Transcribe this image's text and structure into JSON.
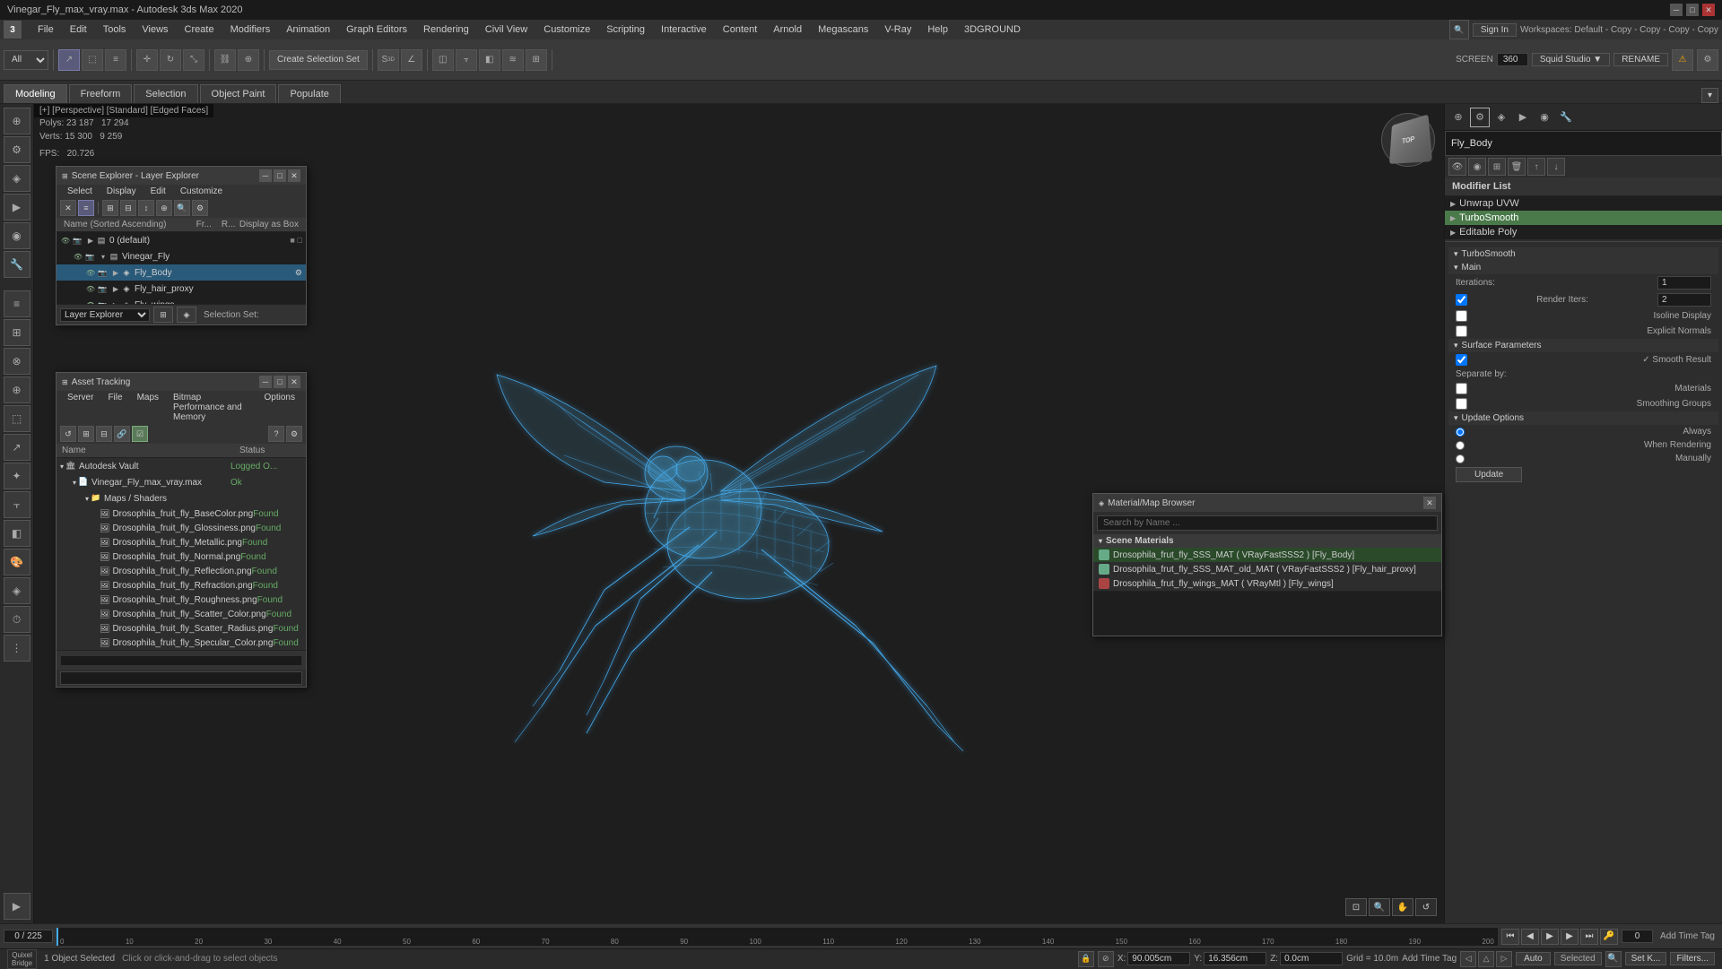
{
  "app": {
    "title": "Vinegar_Fly_max_vray.max - Autodesk 3ds Max 2020",
    "window_controls": [
      "minimize",
      "restore",
      "close"
    ]
  },
  "menu": {
    "items": [
      "File",
      "Edit",
      "Tools",
      "Views",
      "Create",
      "Modifiers",
      "Animation",
      "Graph Editors",
      "Rendering",
      "Civil View",
      "Customize",
      "Scripting",
      "Interactive",
      "Content",
      "Arnold",
      "Megascans",
      "V-Ray",
      "Help",
      "3DGROUND"
    ]
  },
  "toolbar": {
    "create_selection_label": "Create Selection Set",
    "screen_label": "SCREEN",
    "frame_label": "360",
    "workspace_label": "Squid Studio ▼",
    "rename_label": "RENAME",
    "filter_label": "All"
  },
  "tabs": {
    "items": [
      "Modeling",
      "Freeform",
      "Selection",
      "Object Paint",
      "Populate"
    ]
  },
  "viewport": {
    "header": "[+] [Perspective] [Standard] [Edged Faces]",
    "stats": {
      "polys_label": "Polys:",
      "polys_total": "23 187",
      "polys_value": "17 294",
      "verts_label": "Verts:",
      "verts_total": "15 300",
      "verts_value": "9 259",
      "fps_label": "FPS:",
      "fps_value": "20.726"
    }
  },
  "scene_explorer": {
    "title": "Scene Explorer - Layer Explorer",
    "menu": [
      "Select",
      "Display",
      "Edit",
      "Customize"
    ],
    "columns": {
      "name": "Name (Sorted Ascending)",
      "fr": "Fr...",
      "r": "R...",
      "display": "Display as Box"
    },
    "tree": [
      {
        "indent": 0,
        "expand": false,
        "name": "0 (default)",
        "level": 0
      },
      {
        "indent": 1,
        "expand": true,
        "name": "Vinegar_Fly",
        "level": 1
      },
      {
        "indent": 2,
        "expand": false,
        "name": "Fly_Body",
        "level": 2,
        "selected": true
      },
      {
        "indent": 2,
        "expand": false,
        "name": "Fly_hair_proxy",
        "level": 2
      },
      {
        "indent": 2,
        "expand": false,
        "name": "Fly_wings",
        "level": 2
      }
    ],
    "footer": {
      "label": "Layer Explorer",
      "selection_set_label": "Selection Set:"
    }
  },
  "asset_tracking": {
    "title": "Asset Tracking",
    "menu": [
      "Server",
      "File",
      "Maps",
      "Bitmap Performance and Memory",
      "Options"
    ],
    "columns": [
      "Name",
      "Status"
    ],
    "assets": [
      {
        "indent": 0,
        "type": "folder",
        "name": "Autodesk Vault",
        "status": "Logged O..."
      },
      {
        "indent": 1,
        "type": "file",
        "name": "Vinegar_Fly_max_vray.max",
        "status": "Ok"
      },
      {
        "indent": 2,
        "type": "folder",
        "name": "Maps / Shaders",
        "status": ""
      },
      {
        "indent": 3,
        "type": "image",
        "name": "Drosophila_fruit_fly_BaseColor.png",
        "status": "Found"
      },
      {
        "indent": 3,
        "type": "image",
        "name": "Drosophila_fruit_fly_Glossiness.png",
        "status": "Found"
      },
      {
        "indent": 3,
        "type": "image",
        "name": "Drosophila_fruit_fly_Metallic.png",
        "status": "Found"
      },
      {
        "indent": 3,
        "type": "image",
        "name": "Drosophila_fruit_fly_Normal.png",
        "status": "Found"
      },
      {
        "indent": 3,
        "type": "image",
        "name": "Drosophila_fruit_fly_Reflection.png",
        "status": "Found"
      },
      {
        "indent": 3,
        "type": "image",
        "name": "Drosophila_fruit_fly_Refraction.png",
        "status": "Found"
      },
      {
        "indent": 3,
        "type": "image",
        "name": "Drosophila_fruit_fly_Roughness.png",
        "status": "Found"
      },
      {
        "indent": 3,
        "type": "image",
        "name": "Drosophila_fruit_fly_Scatter_Color.png",
        "status": "Found"
      },
      {
        "indent": 3,
        "type": "image",
        "name": "Drosophila_fruit_fly_Scatter_Radius.png",
        "status": "Found"
      },
      {
        "indent": 3,
        "type": "image",
        "name": "Drosophila_fruit_fly_Specular_Color.png",
        "status": "Found"
      }
    ]
  },
  "material_browser": {
    "title": "Material/Map Browser",
    "search_placeholder": "Search by Name ...",
    "section": "Scene Materials",
    "materials": [
      {
        "name": "Drosophila_frut_fly_SSS_MAT ( VRayFastSSS2 ) [Fly_Body]",
        "selected": true
      },
      {
        "name": "Drosophila_frut_fly_SSS_MAT_old_MAT ( VRayFastSSS2 ) [Fly_hair_proxy]",
        "selected": false
      },
      {
        "name": "Drosophila_frut_fly_wings_MAT ( VRayMtl ) [Fly_wings]",
        "selected": false,
        "has_red": true
      }
    ]
  },
  "right_panel": {
    "object_name": "Fly_Body",
    "modifier_list_label": "Modifier List",
    "modifiers": [
      {
        "name": "Unwrap UVW",
        "selected": false
      },
      {
        "name": "TurboSmooth",
        "selected": true
      },
      {
        "name": "Editable Poly",
        "selected": false
      }
    ],
    "turbosmooth": {
      "label": "TurboSmooth",
      "main_label": "Main",
      "iterations_label": "Iterations:",
      "iterations_value": "1",
      "render_iters_label": "Render Iters:",
      "render_iters_value": "2",
      "isoline_display_label": "Isoline Display",
      "explicit_normals_label": "Explicit Normals",
      "surface_params_label": "Surface Parameters",
      "smooth_result_label": "✓ Smooth Result",
      "separate_by_label": "Separate by:",
      "materials_label": "Materials",
      "smoothing_groups_label": "Smoothing Groups",
      "update_options_label": "Update Options",
      "always_label": "Always",
      "when_rendering_label": "When Rendering",
      "manually_label": "Manually",
      "update_btn_label": "Update"
    }
  },
  "timeline": {
    "current": "0 / 225",
    "markers": [
      "0",
      "10",
      "20",
      "30",
      "40",
      "50",
      "60",
      "70",
      "80",
      "90",
      "100",
      "110",
      "120",
      "130",
      "140",
      "150",
      "160",
      "170",
      "180",
      "190",
      "200"
    ]
  },
  "status_bar": {
    "object_selected": "1 Object Selected",
    "hint": "Click or click-and-drag to select objects",
    "x_label": "X:",
    "x_value": "90.005cm",
    "y_label": "Y:",
    "y_value": "16.356cm",
    "z_label": "Z:",
    "z_value": "0.0cm",
    "grid_label": "Grid = 10.0m",
    "add_time_tag_label": "Add Time Tag",
    "selected_label": "Selected",
    "set_key_label": "Set K...",
    "filters_label": "Filters..."
  },
  "branding": {
    "quixel_label": "Quixel",
    "bridge_label": "Bridge"
  }
}
